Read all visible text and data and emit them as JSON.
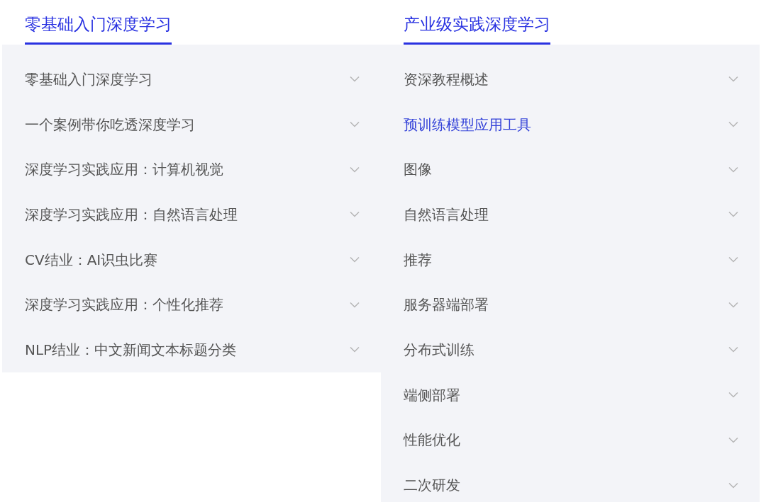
{
  "panels": [
    {
      "title": "零基础入门深度学习",
      "selected": true,
      "items": [
        {
          "label": "零基础入门深度学习",
          "selected": false
        },
        {
          "label": "一个案例带你吃透深度学习",
          "selected": false
        },
        {
          "label": "深度学习实践应用：计算机视觉",
          "selected": false
        },
        {
          "label": "深度学习实践应用：自然语言处理",
          "selected": false
        },
        {
          "label": "CV结业：AI识虫比赛",
          "selected": false
        },
        {
          "label": "深度学习实践应用：个性化推荐",
          "selected": false
        },
        {
          "label": "NLP结业：中文新闻文本标题分类",
          "selected": false
        }
      ]
    },
    {
      "title": "产业级实践深度学习",
      "selected": true,
      "items": [
        {
          "label": "资深教程概述",
          "selected": false
        },
        {
          "label": "预训练模型应用工具",
          "selected": true
        },
        {
          "label": "图像",
          "selected": false
        },
        {
          "label": "自然语言处理",
          "selected": false
        },
        {
          "label": "推荐",
          "selected": false
        },
        {
          "label": "服务器端部署",
          "selected": false
        },
        {
          "label": "分布式训练",
          "selected": false
        },
        {
          "label": "端侧部署",
          "selected": false
        },
        {
          "label": "性能优化",
          "selected": false
        },
        {
          "label": "二次研发",
          "selected": false
        }
      ]
    }
  ]
}
